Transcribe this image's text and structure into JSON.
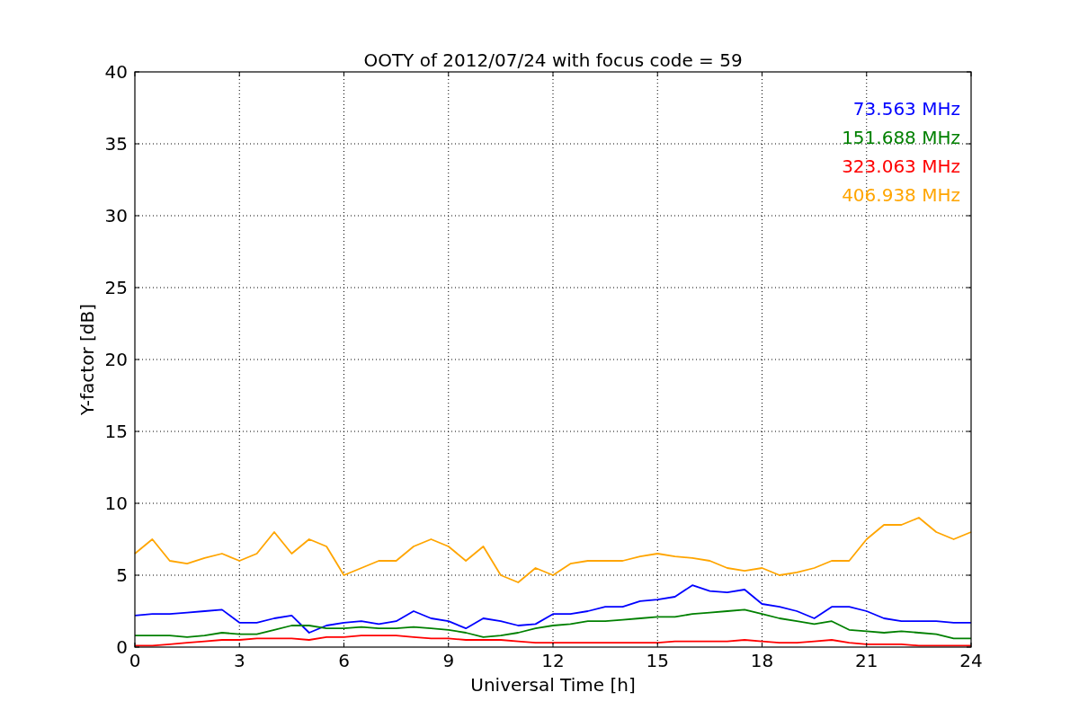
{
  "chart_data": {
    "type": "line",
    "title": "OOTY of 2012/07/24 with focus code = 59",
    "xlabel": "Universal Time [h]",
    "ylabel": "Y-factor [dB]",
    "x": [
      0,
      0.5,
      1,
      1.5,
      2,
      2.5,
      3,
      3.5,
      4,
      4.5,
      5,
      5.5,
      6,
      6.5,
      7,
      7.5,
      8,
      8.5,
      9,
      9.5,
      10,
      10.5,
      11,
      11.5,
      12,
      12.5,
      13,
      13.5,
      14,
      14.5,
      15,
      15.5,
      16,
      16.5,
      17,
      17.5,
      18,
      18.5,
      19,
      19.5,
      20,
      20.5,
      21,
      21.5,
      22,
      22.5,
      23,
      23.5,
      24
    ],
    "series": [
      {
        "name": "73.563 MHz",
        "color": "#0000ff",
        "values": [
          2.2,
          2.3,
          2.3,
          2.4,
          2.5,
          2.6,
          1.7,
          1.7,
          2,
          2.2,
          1,
          1.5,
          1.7,
          1.8,
          1.6,
          1.8,
          2.5,
          2,
          1.8,
          1.3,
          2,
          1.8,
          1.5,
          1.6,
          2.3,
          2.3,
          2.5,
          2.8,
          2.8,
          3.2,
          3.3,
          3.5,
          4.3,
          3.9,
          3.8,
          4,
          3,
          2.8,
          2.5,
          2,
          2.8,
          2.8,
          2.5,
          2,
          1.8,
          1.8,
          1.8,
          1.7,
          1.7
        ]
      },
      {
        "name": "151.688 MHz",
        "color": "#008000",
        "values": [
          0.8,
          0.8,
          0.8,
          0.7,
          0.8,
          1,
          0.9,
          0.9,
          1.2,
          1.5,
          1.5,
          1.3,
          1.3,
          1.4,
          1.3,
          1.3,
          1.4,
          1.3,
          1.2,
          1,
          0.7,
          0.8,
          1,
          1.3,
          1.5,
          1.6,
          1.8,
          1.8,
          1.9,
          2,
          2.1,
          2.1,
          2.3,
          2.4,
          2.5,
          2.6,
          2.3,
          2,
          1.8,
          1.6,
          1.8,
          1.2,
          1.1,
          1,
          1.1,
          1,
          0.9,
          0.6,
          0.6
        ]
      },
      {
        "name": "323.063 MHz",
        "color": "#ff0000",
        "values": [
          0.1,
          0.1,
          0.2,
          0.3,
          0.4,
          0.5,
          0.5,
          0.6,
          0.6,
          0.6,
          0.5,
          0.7,
          0.7,
          0.8,
          0.8,
          0.8,
          0.7,
          0.6,
          0.6,
          0.5,
          0.5,
          0.5,
          0.4,
          0.3,
          0.3,
          0.3,
          0.3,
          0.3,
          0.3,
          0.3,
          0.3,
          0.4,
          0.4,
          0.4,
          0.4,
          0.5,
          0.4,
          0.3,
          0.3,
          0.4,
          0.5,
          0.3,
          0.2,
          0.2,
          0.2,
          0.1,
          0.1,
          0.1,
          0.1
        ]
      },
      {
        "name": "406.938 MHz",
        "color": "#ffa500",
        "values": [
          6.5,
          7.5,
          6,
          5.8,
          6.2,
          6.5,
          6,
          6.5,
          8,
          6.5,
          7.5,
          7,
          5,
          5.5,
          6,
          6,
          7,
          7.5,
          7,
          6,
          7,
          5,
          4.5,
          5.5,
          5,
          5.8,
          6,
          6,
          6,
          6.3,
          6.5,
          6.3,
          6.2,
          6,
          5.5,
          5.3,
          5.5,
          5,
          5.2,
          5.5,
          6,
          6,
          7.5,
          8.5,
          8.5,
          9,
          8,
          7.5,
          8
        ]
      }
    ],
    "grid": true,
    "xlim": [
      0,
      24
    ],
    "ylim": [
      0,
      40
    ],
    "xticks": [
      0,
      3,
      6,
      9,
      12,
      15,
      18,
      21,
      24
    ],
    "yticks": [
      0,
      5,
      10,
      15,
      20,
      25,
      30,
      35,
      40
    ]
  }
}
